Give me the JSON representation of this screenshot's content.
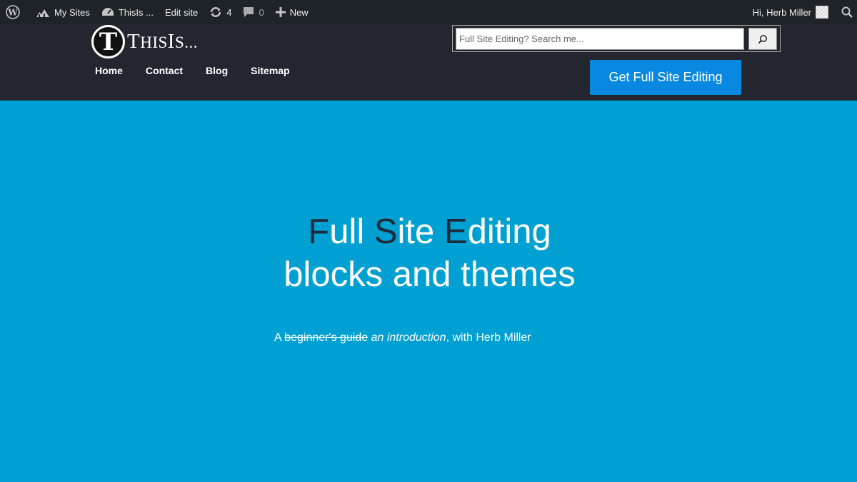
{
  "adminbar": {
    "items": [
      {
        "label": "",
        "icon": "wordpress-icon"
      },
      {
        "label": "My Sites",
        "icon": "my-sites-icon"
      },
      {
        "label": "ThisIs ...",
        "icon": "dashboard-icon"
      },
      {
        "label": "Edit site"
      },
      {
        "label": "4",
        "icon": "updates-icon"
      },
      {
        "label": "0",
        "icon": "comments-icon"
      },
      {
        "label": "New",
        "icon": "plus-icon"
      }
    ],
    "greeting": "Hi, Herb Miller"
  },
  "header": {
    "logo_letter": "T",
    "logo_text_first": "T",
    "logo_text_sc": "HIS",
    "logo_text_cap": "I",
    "logo_text_sc2": "S...",
    "nav": [
      "Home",
      "Contact",
      "Blog",
      "Sitemap"
    ],
    "search_placeholder": "Full Site Editing? Search me...",
    "cta_label": "Get Full Site Editing"
  },
  "hero": {
    "title_line1": [
      {
        "text": "F",
        "accent": true
      },
      {
        "text": "ull ",
        "accent": false
      },
      {
        "text": "S",
        "accent": true
      },
      {
        "text": "ite ",
        "accent": false
      },
      {
        "text": "E",
        "accent": true
      },
      {
        "text": "diting",
        "accent": false
      }
    ],
    "title_line2": "blocks and themes",
    "subtitle_prefix": "A ",
    "subtitle_struck": "beginner's guide",
    "subtitle_italic": "an introduction",
    "subtitle_suffix": ", with Herb Miller"
  },
  "colors": {
    "adminbar_bg": "#1d2327",
    "header_bg": "#23262e",
    "hero_bg": "#00a0d2",
    "cta_bg": "#0888e0",
    "title_accent": "#1e2a3a"
  }
}
